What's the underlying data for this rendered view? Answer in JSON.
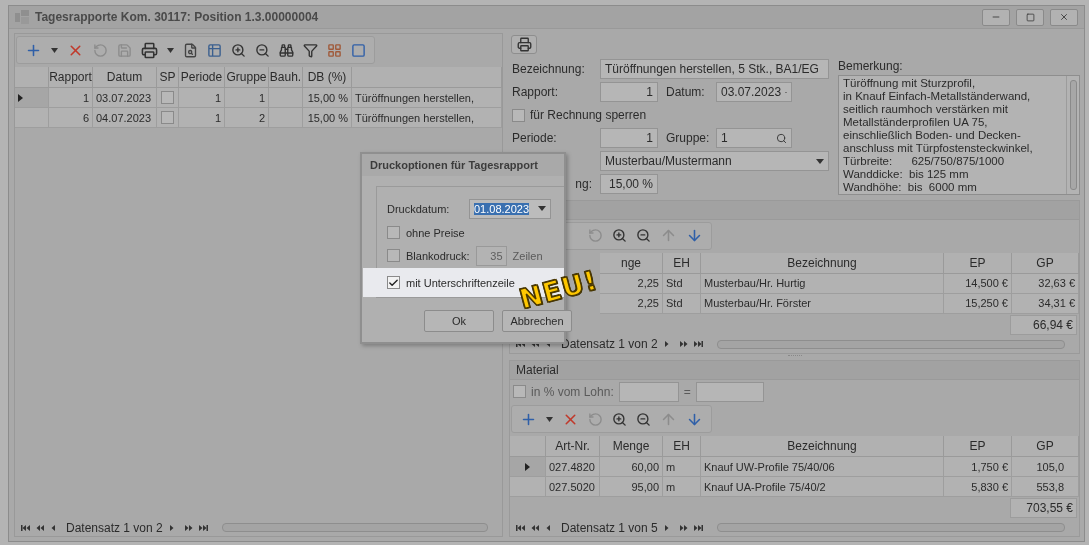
{
  "window": {
    "title": "Tagesrapporte Kom. 30117: Position 1.3.00000004"
  },
  "reports": {
    "columns": [
      "Rapport",
      "Datum",
      "SP",
      "Periode",
      "Gruppe",
      "Bauh.",
      "DB (%)"
    ],
    "rows": [
      {
        "selected": true,
        "rapport": "1",
        "datum": "03.07.2023",
        "sp": false,
        "periode": "1",
        "gruppe": "1",
        "db": "15,00 %",
        "column_9": "Türöffnungen herstellen,"
      },
      {
        "selected": false,
        "rapport": "6",
        "datum": "04.07.2023",
        "sp": false,
        "periode": "1",
        "gruppe": "2",
        "db": "15,00 %",
        "column_9": "Türöffnungen herstellen,"
      }
    ],
    "navigator": "Datensatz 1 von 2"
  },
  "form": {
    "bezeichnung_label": "Bezeichnung:",
    "bezeichnung": "Türöffnungen herstellen, 5 Stk., BA1/EG",
    "rapport_label": "Rapport:",
    "rapport": "1",
    "datum_label": "Datum:",
    "datum": "03.07.2023",
    "lock_label": "für Rechnung sperren",
    "lock_checked": false,
    "periode_label": "Periode:",
    "periode": "1",
    "gruppe_label": "Gruppe:",
    "gruppe": "1",
    "bauherr": "Musterbau/Mustermann",
    "db_label": "ng:",
    "db": "15,00 %",
    "bemerkung_label": "Bemerkung:",
    "bemerkung": [
      "Türöffnung mit Sturzprofil,",
      "in Knauf Einfach-Metallständerwand,",
      "seitlich raumhoch verstärken mit",
      "Metallständerprofilen UA 75,",
      "einschließlich Boden- und Decken-",
      "anschluss mit Türpfostensteckwinkel,",
      "Türbreite:      625/750/875/1000",
      "Wanddicke:  bis 125 mm",
      "Wandhöhe:  bis  6000 mm"
    ]
  },
  "lohn": {
    "columns": [
      "nge",
      "EH",
      "Bezeichnung",
      "EP",
      "GP"
    ],
    "rows": [
      {
        "menge": "2,25",
        "eh": "Std",
        "bezeichnung": "Musterbau/Hr. Hurtig",
        "ep": "14,500 €",
        "gp": "32,63 €"
      },
      {
        "menge": "2,25",
        "eh": "Std",
        "bezeichnung": "Musterbau/Hr. Förster",
        "ep": "15,250 €",
        "gp": "34,31 €"
      }
    ],
    "total": "66,94 €",
    "navigator": "Datensatz 1 von 2"
  },
  "material": {
    "title": "Material",
    "pct_label": "in % vom Lohn:",
    "pct_checked": false,
    "equals": "=",
    "columns": [
      "Art-Nr.",
      "Menge",
      "EH",
      "Bezeichnung",
      "EP",
      "GP"
    ],
    "rows": [
      {
        "selected": true,
        "art_nr": "027.4820",
        "menge": "60,00",
        "eh": "m",
        "bezeichnung": "Knauf UW-Profile  75/40/06",
        "ep": "1,750 €",
        "gp": "105,0"
      },
      {
        "selected": false,
        "art_nr": "027.5020",
        "menge": "95,00",
        "eh": "m",
        "bezeichnung": "Knauf UA-Profile  75/40/2",
        "ep": "5,830 €",
        "gp": "553,8"
      }
    ],
    "total": "703,55 €",
    "navigator": "Datensatz 1 von 5"
  },
  "dialog": {
    "title": "Druckoptionen für Tagesrapport",
    "date_label": "Druckdatum:",
    "date": "01.08.2023",
    "options": [
      {
        "kind": "check",
        "label": "ohne Preise",
        "checked": false,
        "highlighted": false
      },
      {
        "kind": "count",
        "label": "Blankodruck:",
        "checked": false,
        "highlighted": false,
        "value": "35",
        "unit": "Zeilen"
      },
      {
        "kind": "check",
        "label": "mit Unterschriftenzeile",
        "checked": true,
        "highlighted": true
      }
    ],
    "buttons": [
      "Ok",
      "Abbrechen"
    ]
  },
  "badge": "NEU!"
}
